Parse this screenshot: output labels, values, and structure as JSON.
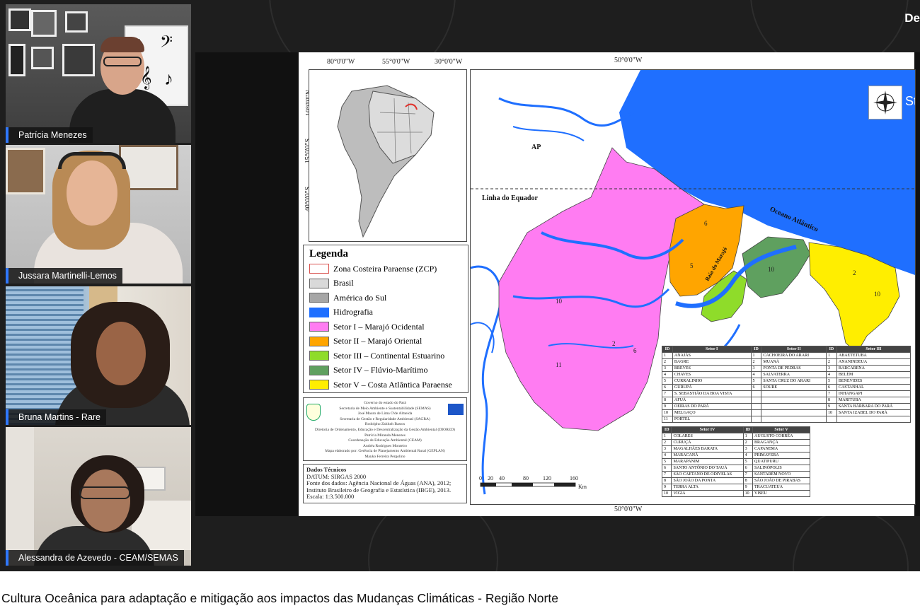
{
  "top_right_text": "De",
  "participants": [
    {
      "name": "Patrícia Menezes"
    },
    {
      "name": "Jussara Martinelli-Lemos"
    },
    {
      "name": "Bruna Martins - Rare"
    },
    {
      "name": "Alessandra de Azevedo - CEAM/SEMAS"
    }
  ],
  "map": {
    "top_coords": [
      "80°0'0\"W",
      "55°0'0\"W",
      "30°0'0\"W",
      "50°0'0\"W"
    ],
    "left_coords": [
      "10°0'0\"N",
      "15°0'0\"S",
      "40°0'0\"S"
    ],
    "bottom_coord": "50°0'0\"W",
    "labels": {
      "ap": "AP",
      "equator": "Linha do Equador",
      "ocean": "Oceano Atlântico",
      "baia": "Baía do Marajó",
      "st": "St"
    },
    "legend_title": "Legenda",
    "legend": [
      {
        "label": "Zona Costeira Paraense (ZCP)",
        "color": "#ffffff",
        "border": "#d9534f"
      },
      {
        "label": "Brasil",
        "color": "#d9d9d9",
        "border": "#666666"
      },
      {
        "label": "América do Sul",
        "color": "#a6a6a6",
        "border": "#666666"
      },
      {
        "label": "Hidrografia",
        "color": "#1f6fff",
        "border": "#1f6fff"
      },
      {
        "label": "Setor I – Marajó Ocidental",
        "color": "#ff7cf2",
        "border": "#666666"
      },
      {
        "label": "Setor II – Marajó Oriental",
        "color": "#ffa500",
        "border": "#666666"
      },
      {
        "label": "Setor III – Continental Estuarino",
        "color": "#8fdc2a",
        "border": "#666666"
      },
      {
        "label": "Setor IV – Flúvio-Marítimo",
        "color": "#5fa05f",
        "border": "#666666"
      },
      {
        "label": "Setor V – Costa Atlântica Paraense",
        "color": "#ffee00",
        "border": "#666666"
      }
    ],
    "credits": [
      "Governo do estado do Pará",
      "Secretaria de Meio Ambiente e Sustentabilidade (SEMAS)",
      "José Mauro de Lima O'de Almeida",
      "Secretaria de Gestão e Regularidade Ambiental (SAGRA)",
      "Rodolpho Zahluth Bastos",
      "Diretoria de Ordenamento, Educação e Descentralização da Gestão Ambiental (DIORED)",
      "Patrícia Miranda Menezes",
      "Coordenação de Educação Ambiental (CEAM)",
      "Andréa Rodrigues Monteiro",
      "Mapa elaborado por: Gerência de Planejamento Ambiental Rural (GEPLAN)",
      "Mayko Ferreira Pergolino"
    ],
    "technical_title": "Dados Técnicos",
    "technical_lines": [
      "DATUM: SIRGAS 2000",
      "Fonte dos dados: Agência Nacional de Águas (ANA), 2012;",
      "Instituto Brasileiro de Geografia e Estatística (IBGE), 2013.",
      "Escala: 1:3.500.000"
    ],
    "scale_ticks": [
      "0",
      "20",
      "40",
      "80",
      "120",
      "160"
    ],
    "scale_unit": "Km",
    "table_top": {
      "headers": [
        "ID",
        "Setor I",
        "ID",
        "Setor II",
        "ID",
        "Setor III"
      ],
      "rows": [
        [
          "1",
          "ANAJÁS",
          "1",
          "CACHOEIRA DO ARARI",
          "1",
          "ABAETETUBA"
        ],
        [
          "2",
          "BAGRE",
          "2",
          "MUANÁ",
          "2",
          "ANANINDEUA"
        ],
        [
          "3",
          "BREVES",
          "3",
          "PONTA DE PEDRAS",
          "3",
          "BARCARENA"
        ],
        [
          "4",
          "CHAVES",
          "4",
          "SALVATERRA",
          "4",
          "BELÉM"
        ],
        [
          "5",
          "CURRALINHO",
          "5",
          "SANTA CRUZ DO ARARI",
          "5",
          "BENEVIDES"
        ],
        [
          "6",
          "GURUPÁ",
          "6",
          "SOURE",
          "6",
          "CASTANHAL"
        ],
        [
          "7",
          "S. SEBASTIÃO DA BOA VISTA",
          "",
          "",
          "7",
          "INHANGAPI"
        ],
        [
          "8",
          "AFUÁ",
          "",
          "",
          "8",
          "MARITUBA"
        ],
        [
          "9",
          "OEIRAS DO PARÁ",
          "",
          "",
          "9",
          "SANTA BÁRBARA DO PARÁ"
        ],
        [
          "10",
          "MELGAÇO",
          "",
          "",
          "10",
          "SANTA IZABEL DO PARÁ"
        ],
        [
          "11",
          "PORTEL",
          "",
          "",
          "",
          ""
        ]
      ]
    },
    "table_bottom": {
      "headers": [
        "ID",
        "Setor IV",
        "ID",
        "Setor V"
      ],
      "rows": [
        [
          "1",
          "COLARES",
          "1",
          "AUGUSTO CORRÊA"
        ],
        [
          "2",
          "CURUÇÁ",
          "2",
          "BRAGANÇA"
        ],
        [
          "3",
          "MAGALHÃES BARATA",
          "3",
          "CAPANEMA"
        ],
        [
          "4",
          "MARACANÃ",
          "4",
          "PRIMAVERA"
        ],
        [
          "5",
          "MARAPANIM",
          "5",
          "QUATIPURU"
        ],
        [
          "6",
          "SANTO ANTÔNIO DO TAUÁ",
          "6",
          "SALINÓPOLIS"
        ],
        [
          "7",
          "SÃO CAETANO DE ODIVELAS",
          "7",
          "SANTARÉM NOVO"
        ],
        [
          "8",
          "SÃO JOÃO DA PONTA",
          "8",
          "SÃO JOÃO DE PIRABAS"
        ],
        [
          "9",
          "TERRA ALTA",
          "9",
          "TRACUATEUA"
        ],
        [
          "10",
          "VIGIA",
          "10",
          "VISEU"
        ]
      ]
    }
  },
  "caption": "Cultura Oceânica para adaptação e mitigação aos impactos das Mudanças Climáticas - Região Norte"
}
